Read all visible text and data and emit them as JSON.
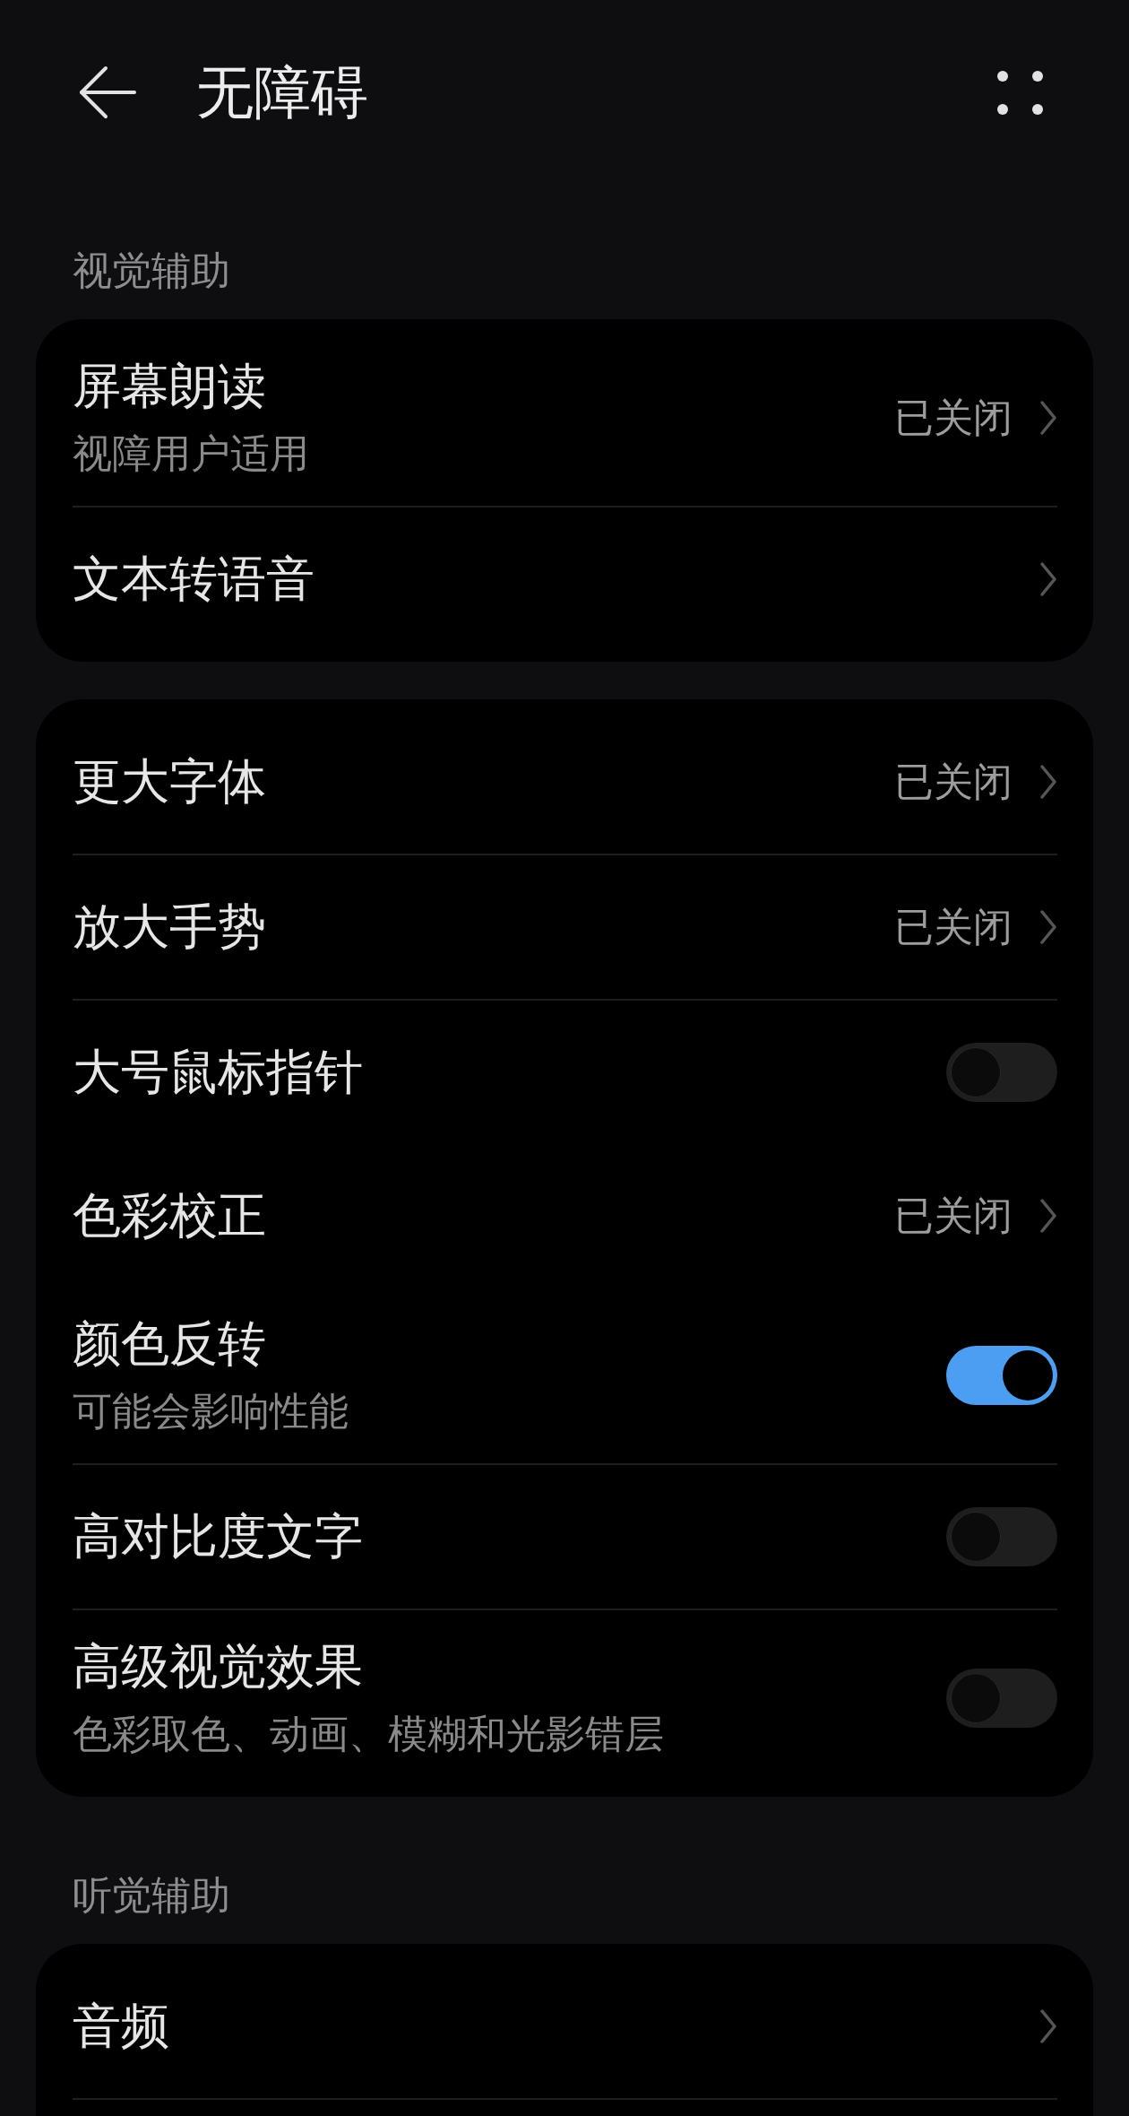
{
  "header": {
    "title": "无障碍"
  },
  "sections": [
    {
      "title": "视觉辅助",
      "cards": [
        {
          "rows": [
            {
              "kind": "link",
              "title": "屏幕朗读",
              "subtitle": "视障用户适用",
              "value": "已关闭",
              "divider": true
            },
            {
              "kind": "link",
              "title": "文本转语音",
              "divider": false
            }
          ]
        },
        {
          "rows": [
            {
              "kind": "link",
              "title": "更大字体",
              "value": "已关闭",
              "divider": true
            },
            {
              "kind": "link",
              "title": "放大手势",
              "value": "已关闭",
              "divider": true
            },
            {
              "kind": "toggle",
              "title": "大号鼠标指针",
              "on": false,
              "divider": false
            },
            {
              "kind": "link",
              "title": "色彩校正",
              "value": "已关闭",
              "divider": false
            },
            {
              "kind": "toggle",
              "title": "颜色反转",
              "subtitle": "可能会影响性能",
              "on": true,
              "divider": true
            },
            {
              "kind": "toggle",
              "title": "高对比度文字",
              "on": false,
              "divider": true
            },
            {
              "kind": "toggle",
              "title": "高级视觉效果",
              "subtitle": "色彩取色、动画、模糊和光影错层",
              "on": false,
              "divider": false
            }
          ]
        }
      ]
    },
    {
      "title": "听觉辅助",
      "cards": [
        {
          "rows": [
            {
              "kind": "link",
              "title": "音频",
              "divider": true
            }
          ]
        }
      ]
    }
  ]
}
